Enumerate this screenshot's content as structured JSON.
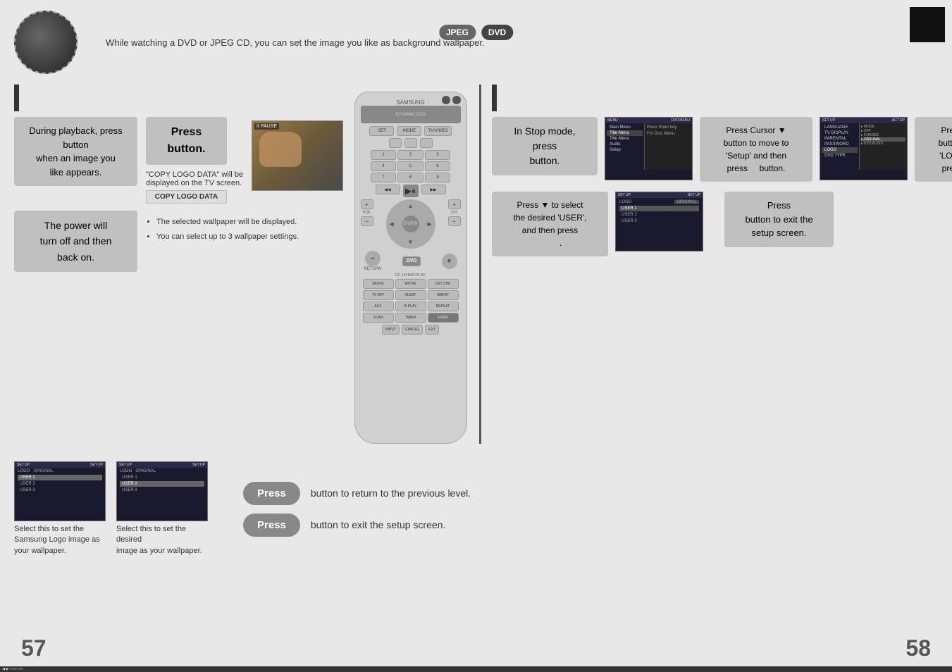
{
  "header": {
    "badge_jpeg": "JPEG",
    "badge_dvd": "DVD",
    "description": "While watching a DVD or JPEG CD, you can set the image you like as background wallpaper.",
    "brand": "SAMSUNG"
  },
  "left_section": {
    "step1": {
      "main_text": "During playback, press\nbutton\nwhen an image you\nlike appears.",
      "press_text": "Press\nbutton."
    },
    "note": "\"COPY LOGO DATA\" will be\ndisplayed on the TV screen.",
    "copy_logo_label": "COPY LOGO DATA",
    "step2": {
      "main_text": "The power will\nturn off and then\nback on.",
      "bullet1": "The selected wallpaper will be displayed.",
      "bullet2": "You can select up to 3 wallpaper settings."
    }
  },
  "right_section": {
    "step1": {
      "in_stop_text": "In Stop mode,\npress\nbutton.",
      "cursor_text1": "Press Cursor ▼\nbutton to move to\n'Setup' and then\npress       button.",
      "cursor_text2": "Press Cursor ▼\nbutton to move to\n'LOGO' and then\npress       button."
    },
    "step2": {
      "down_text": "Press ▼ to select\nthe desired 'USER',\nand then press\n.",
      "exit_text": "Press\nbutton to exit the\nsetup screen."
    }
  },
  "bottom": {
    "caption1": "Select this to set the\nSamsung Logo image as\nyour wallpaper.",
    "caption2": "Select this to set the desired\nimage as your wallpaper.",
    "press1_text": "Press",
    "press1_desc": "button to return to the previous level.",
    "press2_text": "Press",
    "press2_desc": "button to exit the setup screen."
  },
  "pages": {
    "left": "57",
    "right": "58"
  },
  "remote": {
    "brand": "SAMSUNG",
    "display_text": "DYNAMIC·DVD"
  },
  "tv_screens": {
    "menu1": {
      "title": "DVD MENU",
      "items": [
        "Main Menu",
        "Title Menu",
        "Title Menu",
        "Audio",
        "Setup"
      ],
      "right_items": [
        "Press Enter key",
        "For Disc Menu"
      ]
    },
    "menu2": {
      "title": "SET UP",
      "items": [
        "LANGUAGE",
        "TV DISPLAY",
        "PARENTAL",
        "PASSWORD",
        "LOGO",
        "DVD TYPE"
      ],
      "values": [
        "",
        "MODE",
        "OFF",
        "CHANGE",
        "ORIGINAL",
        "DVD AUDIO"
      ]
    },
    "menu3": {
      "title": "SET UP",
      "items": [
        "LANGUAGE",
        "TV DISPLAY",
        "PARENTAL",
        "PASSWORD",
        "LOGO",
        "DVD TYPE"
      ],
      "values": [
        "",
        "MODE",
        "OFF",
        "CHANGE",
        "ORIGINAL",
        "DVD AUDIO"
      ],
      "highlighted": "LOGO"
    },
    "menu4": {
      "title": "SET UP",
      "logo_items": [
        "USER 1",
        "USER 2",
        "USER 3"
      ]
    },
    "menu5": {
      "title": "SET UP",
      "logo_items": [
        "USER 1",
        "USER 2",
        "USER 3"
      ],
      "selected": "USER 1"
    },
    "menu6": {
      "title": "SET UP",
      "logo_items": [
        "USER 1",
        "USER 2",
        "USER 3"
      ],
      "selected": "USER 2"
    }
  }
}
